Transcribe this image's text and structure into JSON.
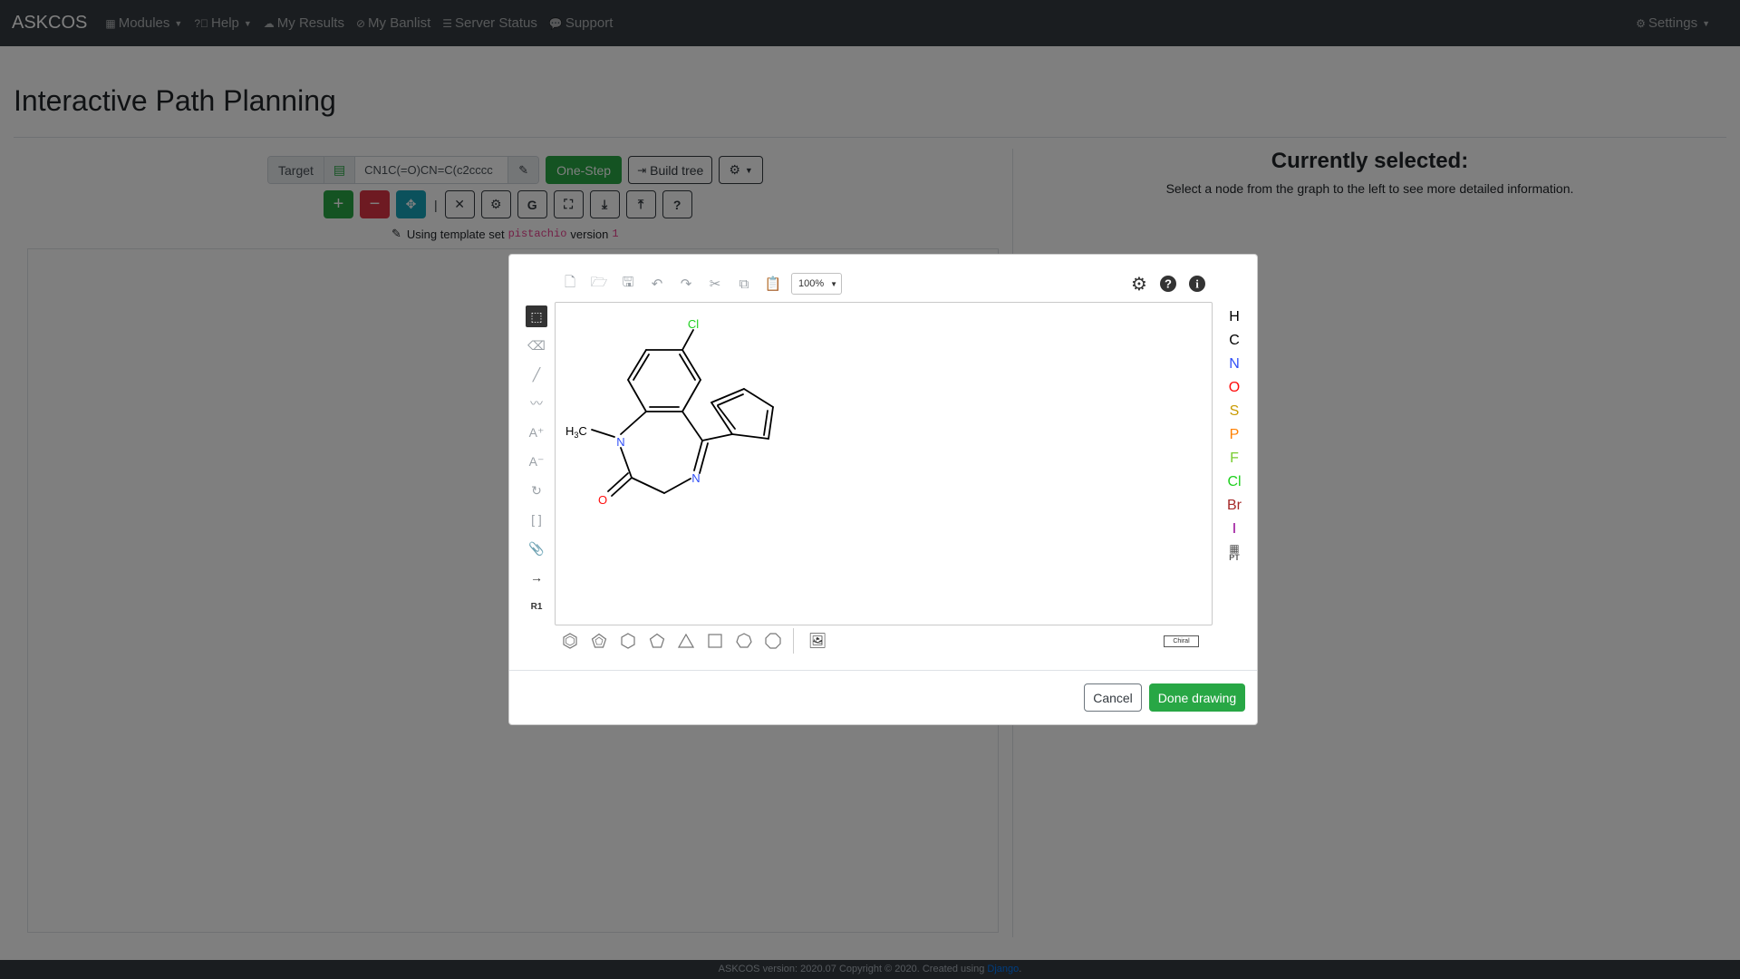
{
  "navbar": {
    "brand": "ASKCOS",
    "items": [
      {
        "label": "Modules",
        "icon": "grid-icon",
        "dropdown": true
      },
      {
        "label": "Help",
        "icon": "question-circle-icon",
        "dropdown": true
      },
      {
        "label": "My Results",
        "icon": "cloud-icon",
        "dropdown": false
      },
      {
        "label": "My Banlist",
        "icon": "ban-icon",
        "dropdown": false
      },
      {
        "label": "Server Status",
        "icon": "server-icon",
        "dropdown": false
      },
      {
        "label": "Support",
        "icon": "comment-icon",
        "dropdown": false
      }
    ],
    "settings_label": "Settings"
  },
  "page": {
    "title": "Interactive Path Planning",
    "target_label": "Target",
    "target_smiles": "CN1C(=O)CN=C(c2cccc",
    "one_step_label": "One-Step",
    "build_tree_label": "Build tree",
    "template_prefix": "Using template set",
    "template_set": "pistachio",
    "template_version_label": "version",
    "template_version": "1",
    "toolbar2_pipe": "|",
    "g_label": "G",
    "help_label": "?"
  },
  "details": {
    "title": "Currently selected:",
    "hint": "Select a node from the graph to the left to see more detailed information."
  },
  "modal": {
    "zoom": "100%",
    "elements": [
      {
        "symbol": "H",
        "color": "#000000"
      },
      {
        "symbol": "C",
        "color": "#000000"
      },
      {
        "symbol": "N",
        "color": "#304FF7"
      },
      {
        "symbol": "O",
        "color": "#FF0D0D"
      },
      {
        "symbol": "S",
        "color": "#C99A00"
      },
      {
        "symbol": "P",
        "color": "#FF8000"
      },
      {
        "symbol": "F",
        "color": "#78CC30"
      },
      {
        "symbol": "Cl",
        "color": "#1FD01F"
      },
      {
        "symbol": "Br",
        "color": "#A62929"
      },
      {
        "symbol": "I",
        "color": "#940094"
      }
    ],
    "periodic_table_label": "PT",
    "rgroup_label": "R1",
    "chiral_label": "Chiral",
    "molecule_labels": {
      "cl": "Cl",
      "n1": "N",
      "n2": "N",
      "o": "O",
      "ch3": "H",
      "ch3_c": "C",
      "ch3_sub": "3"
    },
    "cancel_label": "Cancel",
    "done_label": "Done drawing"
  },
  "footer": {
    "text": "ASKCOS version: 2020.07 Copyright © 2020. Created using ",
    "link": "Django",
    "end": "."
  },
  "colors": {
    "navbar": "#343a40",
    "success": "#28a745",
    "danger": "#dc3545",
    "info": "#17a2b8"
  }
}
